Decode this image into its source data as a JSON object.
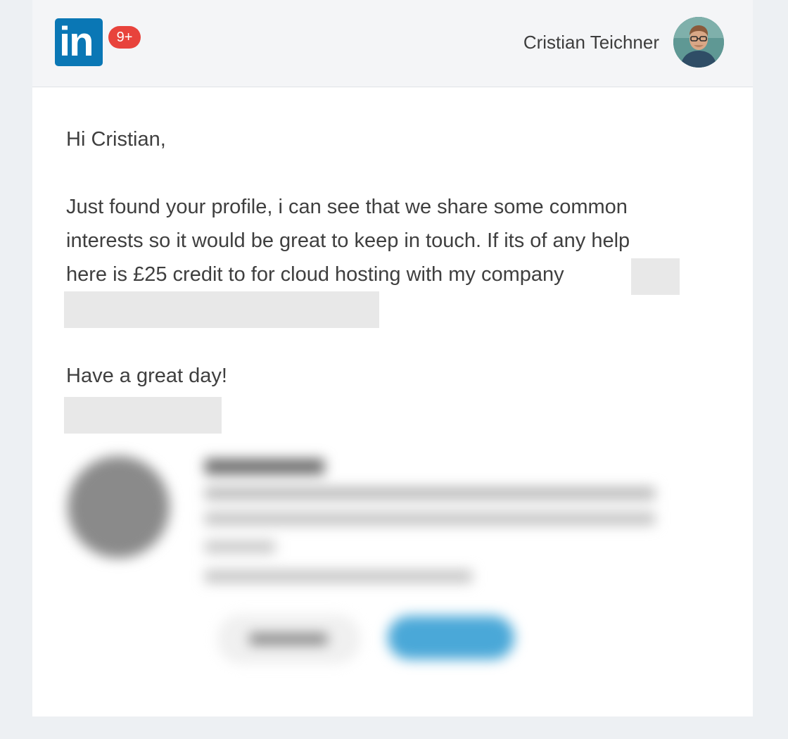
{
  "header": {
    "notification_count": "9+",
    "logo_text": "in",
    "user_name": "Cristian Teichner"
  },
  "message": {
    "greeting": "Hi Cristian,",
    "line1": "Just found your profile, i can see that we share some common",
    "line2": "interests so it would be great to keep in touch. If its of any help",
    "line3": "here is £25 credit to for cloud hosting with my company",
    "closing": "Have a great day!"
  },
  "colors": {
    "brand": "#0a77b5",
    "badge": "#e8433c",
    "page_bg": "#edf0f3",
    "header_bg": "#f4f5f7",
    "text": "#3f3f3f",
    "accent_button": "#4aa8d8"
  },
  "icons": {
    "logo": "linkedin-logo-icon",
    "badge": "notification-badge",
    "avatar": "user-avatar"
  }
}
